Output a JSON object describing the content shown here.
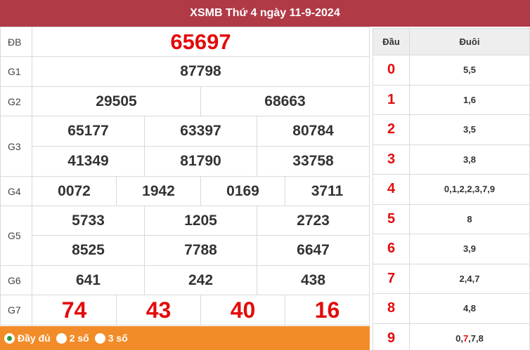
{
  "header": {
    "title": "XSMB Thứ 4 ngày 11-9-2024"
  },
  "prizes": {
    "db": {
      "label": "ĐB",
      "values": [
        "65697"
      ]
    },
    "g1": {
      "label": "G1",
      "values": [
        "87798"
      ]
    },
    "g2": {
      "label": "G2",
      "values": [
        "29505",
        "68663"
      ]
    },
    "g3": {
      "label": "G3",
      "values": [
        "65177",
        "63397",
        "80784",
        "41349",
        "81790",
        "33758"
      ]
    },
    "g4": {
      "label": "G4",
      "values": [
        "0072",
        "1942",
        "0169",
        "3711"
      ]
    },
    "g5": {
      "label": "G5",
      "values": [
        "5733",
        "1205",
        "2723",
        "8525",
        "7788",
        "6647"
      ]
    },
    "g6": {
      "label": "G6",
      "values": [
        "641",
        "242",
        "438"
      ]
    },
    "g7": {
      "label": "G7",
      "values": [
        "74",
        "43",
        "40",
        "16"
      ]
    }
  },
  "filter": {
    "options": [
      {
        "label": "Đầy đủ",
        "selected": true
      },
      {
        "label": "2 số",
        "selected": false
      },
      {
        "label": "3 số",
        "selected": false
      }
    ]
  },
  "dau_duoi": {
    "headers": {
      "dau": "Đầu",
      "duoi": "Đuôi"
    },
    "rows": [
      {
        "dau": "0",
        "duoi": "5,5"
      },
      {
        "dau": "1",
        "duoi": "1,6"
      },
      {
        "dau": "2",
        "duoi": "3,5"
      },
      {
        "dau": "3",
        "duoi": "3,8"
      },
      {
        "dau": "4",
        "duoi": "0,1,2,2,3,7,9"
      },
      {
        "dau": "5",
        "duoi": "8"
      },
      {
        "dau": "6",
        "duoi": "3,9"
      },
      {
        "dau": "7",
        "duoi": "2,4,7"
      },
      {
        "dau": "8",
        "duoi": "4,8"
      },
      {
        "dau": "9",
        "duoi_parts": [
          "0,",
          "7",
          ",7,8"
        ]
      }
    ]
  },
  "colors": {
    "header_bg": "#b13a47",
    "filter_bg": "#f28c28",
    "highlight": "#e30b0b"
  }
}
